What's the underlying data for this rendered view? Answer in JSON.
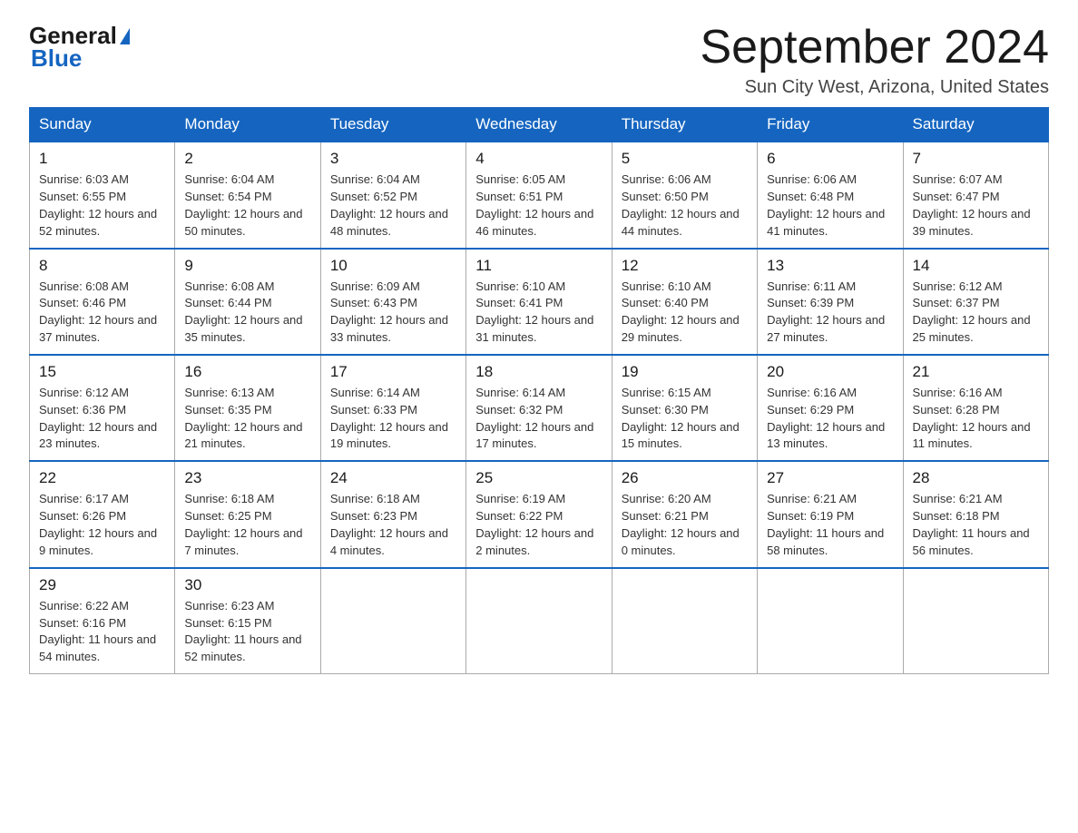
{
  "header": {
    "logo_general": "General",
    "logo_blue": "Blue",
    "title": "September 2024",
    "subtitle": "Sun City West, Arizona, United States"
  },
  "days_of_week": [
    "Sunday",
    "Monday",
    "Tuesday",
    "Wednesday",
    "Thursday",
    "Friday",
    "Saturday"
  ],
  "weeks": [
    [
      {
        "date": "1",
        "sunrise": "6:03 AM",
        "sunset": "6:55 PM",
        "daylight": "12 hours and 52 minutes."
      },
      {
        "date": "2",
        "sunrise": "6:04 AM",
        "sunset": "6:54 PM",
        "daylight": "12 hours and 50 minutes."
      },
      {
        "date": "3",
        "sunrise": "6:04 AM",
        "sunset": "6:52 PM",
        "daylight": "12 hours and 48 minutes."
      },
      {
        "date": "4",
        "sunrise": "6:05 AM",
        "sunset": "6:51 PM",
        "daylight": "12 hours and 46 minutes."
      },
      {
        "date": "5",
        "sunrise": "6:06 AM",
        "sunset": "6:50 PM",
        "daylight": "12 hours and 44 minutes."
      },
      {
        "date": "6",
        "sunrise": "6:06 AM",
        "sunset": "6:48 PM",
        "daylight": "12 hours and 41 minutes."
      },
      {
        "date": "7",
        "sunrise": "6:07 AM",
        "sunset": "6:47 PM",
        "daylight": "12 hours and 39 minutes."
      }
    ],
    [
      {
        "date": "8",
        "sunrise": "6:08 AM",
        "sunset": "6:46 PM",
        "daylight": "12 hours and 37 minutes."
      },
      {
        "date": "9",
        "sunrise": "6:08 AM",
        "sunset": "6:44 PM",
        "daylight": "12 hours and 35 minutes."
      },
      {
        "date": "10",
        "sunrise": "6:09 AM",
        "sunset": "6:43 PM",
        "daylight": "12 hours and 33 minutes."
      },
      {
        "date": "11",
        "sunrise": "6:10 AM",
        "sunset": "6:41 PM",
        "daylight": "12 hours and 31 minutes."
      },
      {
        "date": "12",
        "sunrise": "6:10 AM",
        "sunset": "6:40 PM",
        "daylight": "12 hours and 29 minutes."
      },
      {
        "date": "13",
        "sunrise": "6:11 AM",
        "sunset": "6:39 PM",
        "daylight": "12 hours and 27 minutes."
      },
      {
        "date": "14",
        "sunrise": "6:12 AM",
        "sunset": "6:37 PM",
        "daylight": "12 hours and 25 minutes."
      }
    ],
    [
      {
        "date": "15",
        "sunrise": "6:12 AM",
        "sunset": "6:36 PM",
        "daylight": "12 hours and 23 minutes."
      },
      {
        "date": "16",
        "sunrise": "6:13 AM",
        "sunset": "6:35 PM",
        "daylight": "12 hours and 21 minutes."
      },
      {
        "date": "17",
        "sunrise": "6:14 AM",
        "sunset": "6:33 PM",
        "daylight": "12 hours and 19 minutes."
      },
      {
        "date": "18",
        "sunrise": "6:14 AM",
        "sunset": "6:32 PM",
        "daylight": "12 hours and 17 minutes."
      },
      {
        "date": "19",
        "sunrise": "6:15 AM",
        "sunset": "6:30 PM",
        "daylight": "12 hours and 15 minutes."
      },
      {
        "date": "20",
        "sunrise": "6:16 AM",
        "sunset": "6:29 PM",
        "daylight": "12 hours and 13 minutes."
      },
      {
        "date": "21",
        "sunrise": "6:16 AM",
        "sunset": "6:28 PM",
        "daylight": "12 hours and 11 minutes."
      }
    ],
    [
      {
        "date": "22",
        "sunrise": "6:17 AM",
        "sunset": "6:26 PM",
        "daylight": "12 hours and 9 minutes."
      },
      {
        "date": "23",
        "sunrise": "6:18 AM",
        "sunset": "6:25 PM",
        "daylight": "12 hours and 7 minutes."
      },
      {
        "date": "24",
        "sunrise": "6:18 AM",
        "sunset": "6:23 PM",
        "daylight": "12 hours and 4 minutes."
      },
      {
        "date": "25",
        "sunrise": "6:19 AM",
        "sunset": "6:22 PM",
        "daylight": "12 hours and 2 minutes."
      },
      {
        "date": "26",
        "sunrise": "6:20 AM",
        "sunset": "6:21 PM",
        "daylight": "12 hours and 0 minutes."
      },
      {
        "date": "27",
        "sunrise": "6:21 AM",
        "sunset": "6:19 PM",
        "daylight": "11 hours and 58 minutes."
      },
      {
        "date": "28",
        "sunrise": "6:21 AM",
        "sunset": "6:18 PM",
        "daylight": "11 hours and 56 minutes."
      }
    ],
    [
      {
        "date": "29",
        "sunrise": "6:22 AM",
        "sunset": "6:16 PM",
        "daylight": "11 hours and 54 minutes."
      },
      {
        "date": "30",
        "sunrise": "6:23 AM",
        "sunset": "6:15 PM",
        "daylight": "11 hours and 52 minutes."
      },
      null,
      null,
      null,
      null,
      null
    ]
  ]
}
